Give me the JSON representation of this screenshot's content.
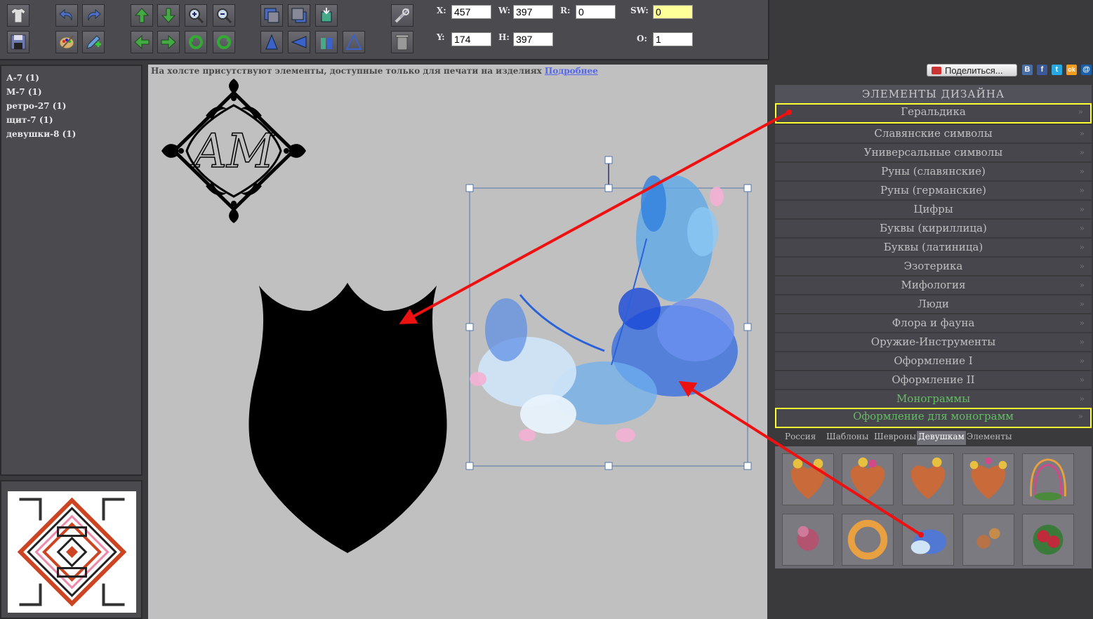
{
  "coords": {
    "x_label": "X:",
    "x_value": "457",
    "w_label": "W:",
    "w_value": "397",
    "r_label": "R:",
    "r_value": "0",
    "sw_label": "SW:",
    "sw_value": "0",
    "y_label": "Y:",
    "y_value": "174",
    "h_label": "H:",
    "h_value": "397",
    "o_label": "O:",
    "o_value": "1"
  },
  "layers": [
    "А-7 (1)",
    "М-7 (1)",
    "ретро-27 (1)",
    "щит-7 (1)",
    "девушки-8 (1)"
  ],
  "canvas": {
    "notice": "На холсте присутствуют элементы, доступные только для печати на изделиях",
    "notice_link": "Подробнее",
    "monogram_letters": "AM"
  },
  "share": {
    "label": "Поделиться...",
    "networks": [
      "В",
      "f",
      "t",
      "ok",
      "@"
    ]
  },
  "design_panel": {
    "title": "ЭЛЕМЕНТЫ ДИЗАЙНА",
    "categories": [
      "Геральдика",
      "Славянские символы",
      "Универсальные символы",
      "Руны (славянские)",
      "Руны (германские)",
      "Цифры",
      "Буквы (кириллица)",
      "Буквы (латиница)",
      "Эзотерика",
      "Мифология",
      "Люди",
      "Флора и фауна",
      "Оружие-Инструменты",
      "Оформление I",
      "Оформление II",
      "Монограммы",
      "Оформление для монограмм"
    ],
    "chevron": "»",
    "subtabs": [
      "Россия",
      "Шаблоны",
      "Шевроны",
      "Девушкам",
      "Элементы"
    ],
    "active_subtab": "Девушкам"
  },
  "colors": {
    "highlight": "#ffff33",
    "arrow": "#ee1111",
    "accent_green": "#66bb66"
  }
}
